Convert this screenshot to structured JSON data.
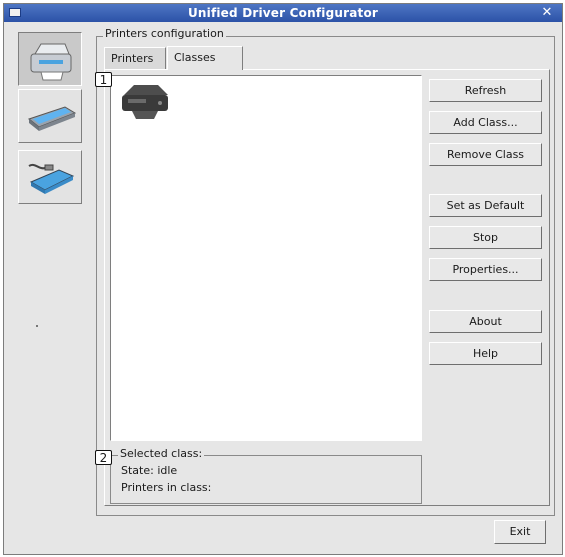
{
  "window": {
    "title": "Unified Driver Configurator",
    "close_glyph": "✕"
  },
  "sidebar": {
    "items": [
      {
        "icon": "printer-icon",
        "active": true
      },
      {
        "icon": "scanner-icon",
        "active": false
      },
      {
        "icon": "port-icon",
        "active": false
      }
    ]
  },
  "group": {
    "title": "Printers configuration"
  },
  "tabs": [
    {
      "label": "Printers",
      "active": false
    },
    {
      "label": "Classes",
      "active": true
    }
  ],
  "callouts": {
    "list": "1",
    "selected": "2"
  },
  "buttons": {
    "refresh": "Refresh",
    "add_class": "Add Class...",
    "remove_class": "Remove Class",
    "set_default": "Set as Default",
    "stop": "Stop",
    "properties": "Properties...",
    "about": "About",
    "help": "Help"
  },
  "selected_class": {
    "title": "Selected class:",
    "state": "State: idle",
    "printers_in_class": "Printers in class:"
  },
  "exit_label": "Exit"
}
